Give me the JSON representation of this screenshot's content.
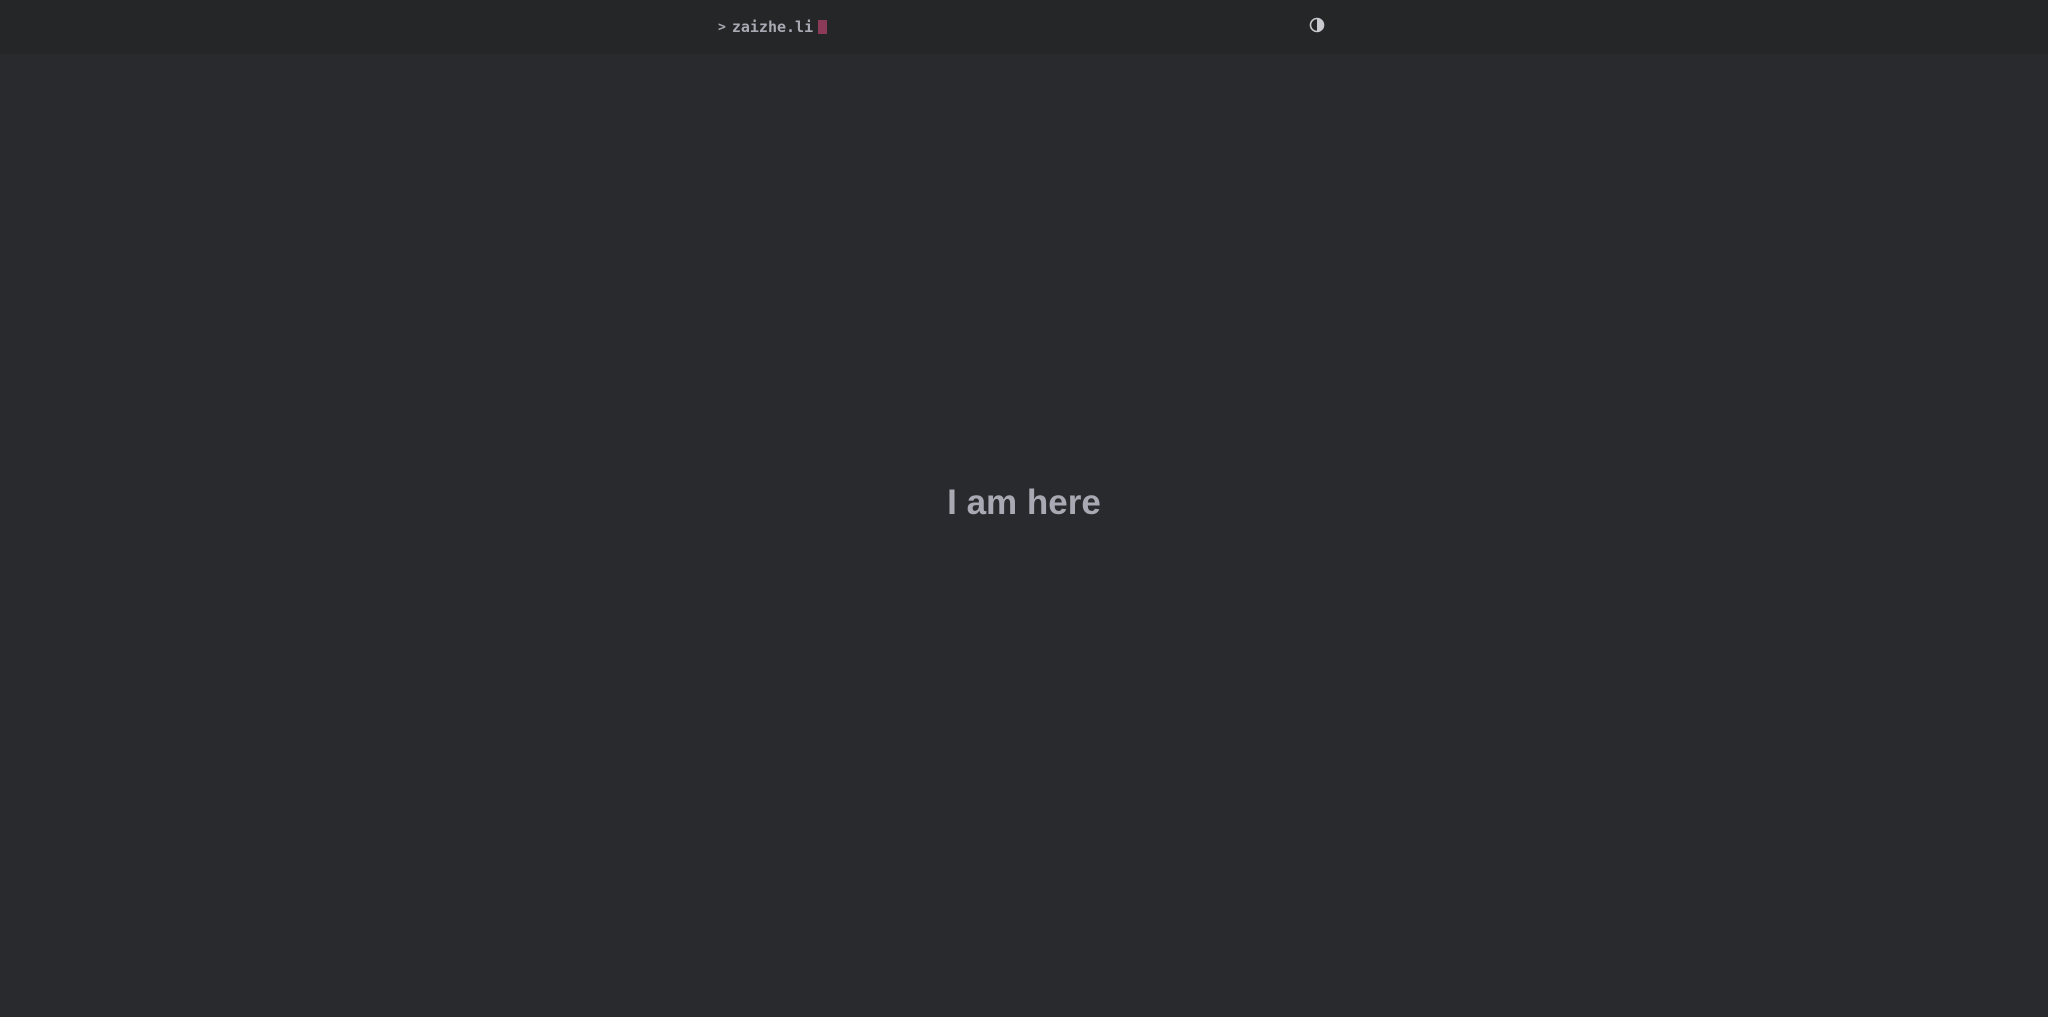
{
  "header": {
    "logo_mark": ">",
    "logo_text": "zaizhe.li",
    "cursor_color": "#8b3a57",
    "theme_toggle_icon": "contrast-half-circle-icon"
  },
  "main": {
    "title": "I am here"
  },
  "colors": {
    "background": "#292a2d",
    "header_background": "#252627",
    "text": "#a9a9b3"
  }
}
